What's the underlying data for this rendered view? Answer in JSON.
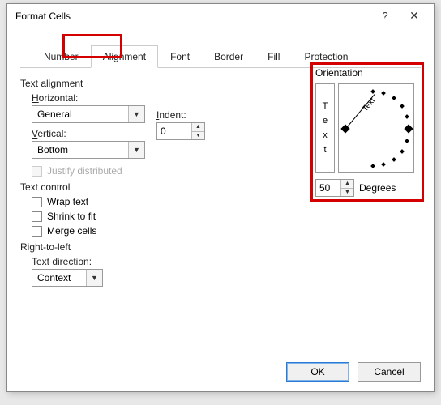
{
  "dialog": {
    "title": "Format Cells"
  },
  "tabs": {
    "number": "Number",
    "alignment": "Alignment",
    "font": "Font",
    "border": "Border",
    "fill": "Fill",
    "protection": "Protection"
  },
  "sections": {
    "text_alignment": "Text alignment",
    "text_control": "Text control",
    "right_to_left": "Right-to-left",
    "orientation": "Orientation"
  },
  "labels": {
    "horizontal": "Horizontal:",
    "vertical": "Vertical:",
    "indent": "Indent:",
    "justify_distributed": "Justify distributed",
    "wrap_text": "Wrap text",
    "shrink_to_fit": "Shrink to fit",
    "merge_cells": "Merge cells",
    "text_direction": "Text direction:",
    "degrees": "Degrees"
  },
  "values": {
    "horizontal": "General",
    "vertical": "Bottom",
    "indent": "0",
    "text_direction": "Context",
    "degrees": "50"
  },
  "orientation_preview": {
    "vertical_text": [
      "T",
      "e",
      "x",
      "t"
    ],
    "needle_text": "Text"
  },
  "buttons": {
    "ok": "OK",
    "cancel": "Cancel"
  }
}
